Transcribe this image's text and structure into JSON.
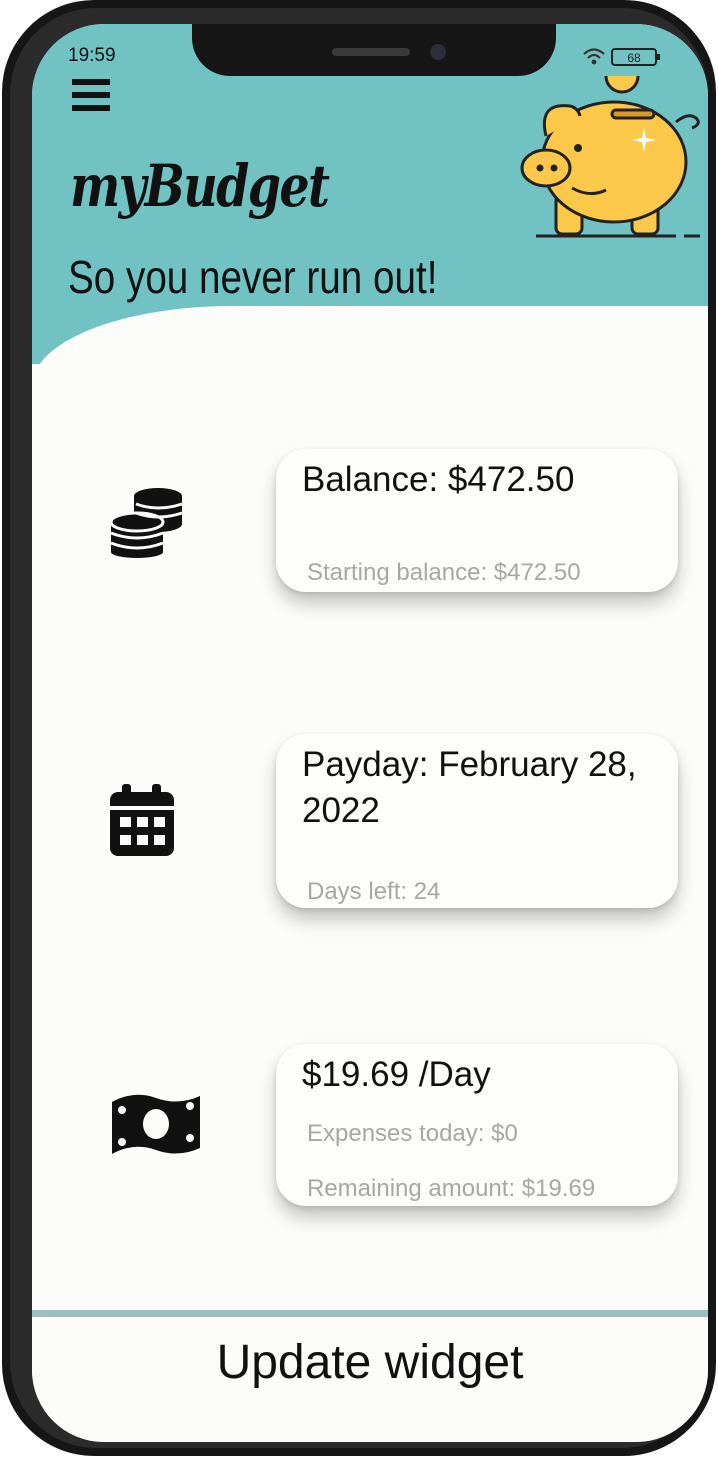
{
  "status": {
    "time": "19:59",
    "battery": "68"
  },
  "app": {
    "title": "myBudget",
    "tagline": "So you never run out!"
  },
  "balance_card": {
    "title": "Balance: $472.50",
    "sub": "Starting balance: $472.50",
    "icon": "coins-icon"
  },
  "payday_card": {
    "title": "Payday: February 28, 2022",
    "sub": "Days left: 24",
    "icon": "calendar-icon"
  },
  "daily_card": {
    "title": "$19.69 /Day",
    "sub1": "Expenses today: $0",
    "sub2": "Remaining amount: $19.69",
    "icon": "money-bill-icon"
  },
  "footer": {
    "update_label": "Update widget"
  },
  "colors": {
    "header": "#71c3c3",
    "background": "#fcfcfa",
    "pig": "#fcc84a",
    "subtext": "#a7a7a7"
  }
}
